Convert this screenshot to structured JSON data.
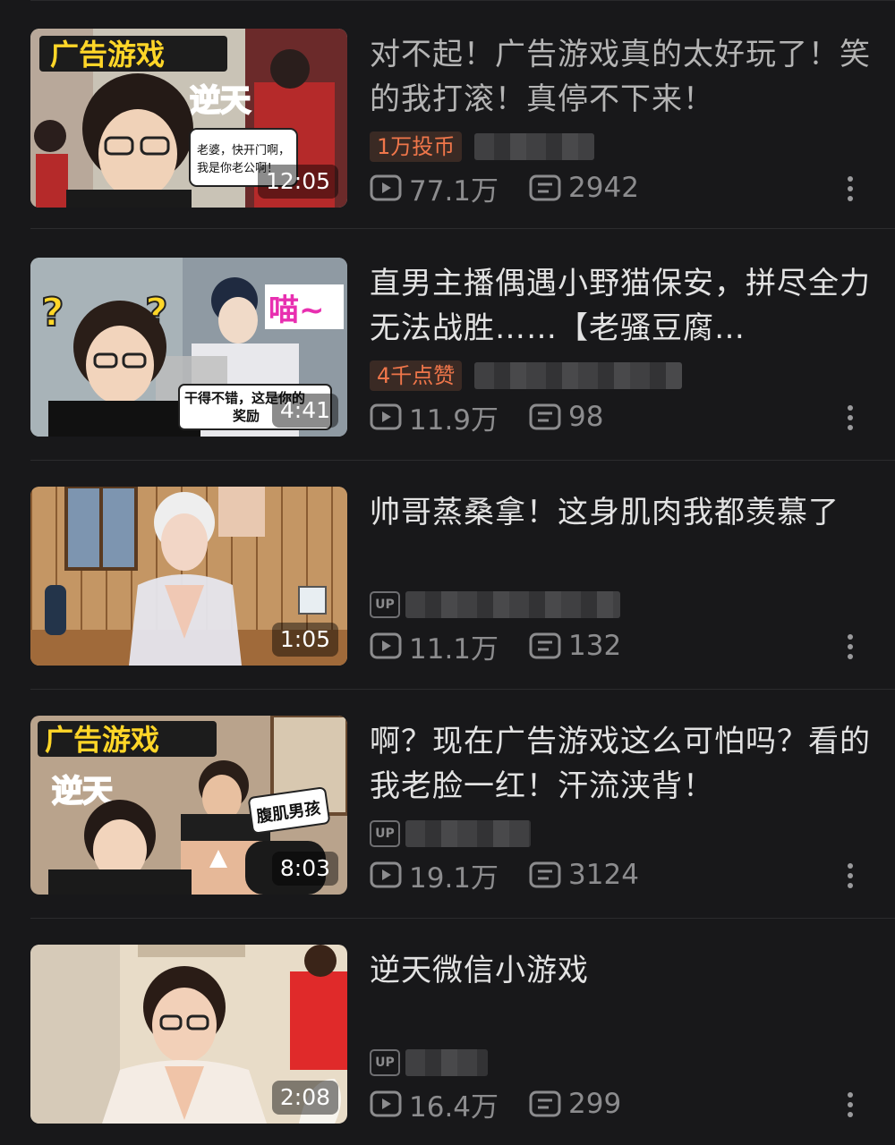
{
  "videos": [
    {
      "title": "对不起！广告游戏真的太好玩了！笑的我打滚！真停不下来！",
      "badge": "1万投币",
      "duration": "12:05",
      "views": "77.1万",
      "comments": "2942",
      "thumb_text": [
        "广告游戏",
        "逆天",
        "老婆，快开门啊，我是你老公啊！"
      ]
    },
    {
      "title": "直男主播偶遇小野猫保安，拼尽全力无法战胜……【老骚豆腐…",
      "badge": "4千点赞",
      "duration": "4:41",
      "views": "11.9万",
      "comments": "98",
      "thumb_text": [
        "?",
        "?",
        "喵~",
        "干得不错，这是你的奖励"
      ]
    },
    {
      "title": "帅哥蒸桑拿！这身肌肉我都羡慕了",
      "badge": "",
      "up_label": "UP",
      "duration": "1:05",
      "views": "11.1万",
      "comments": "132",
      "thumb_text": []
    },
    {
      "title": "啊？现在广告游戏这么可怕吗？看的我老脸一红！汗流浃背！",
      "badge": "",
      "up_label": "UP",
      "duration": "8:03",
      "views": "19.1万",
      "comments": "3124",
      "thumb_text": [
        "广告游戏",
        "逆天",
        "腹肌男孩"
      ]
    },
    {
      "title": "逆天微信小游戏",
      "badge": "",
      "up_label": "UP",
      "duration": "2:08",
      "views": "16.4万",
      "comments": "299",
      "thumb_text": []
    }
  ],
  "icons": {
    "views": "play-count-icon",
    "comments": "danmaku-icon",
    "more": "more-vertical-icon"
  },
  "colors": {
    "background": "#18181a",
    "badge_text": "#f0764a",
    "meta_text": "#8c8c8e"
  }
}
